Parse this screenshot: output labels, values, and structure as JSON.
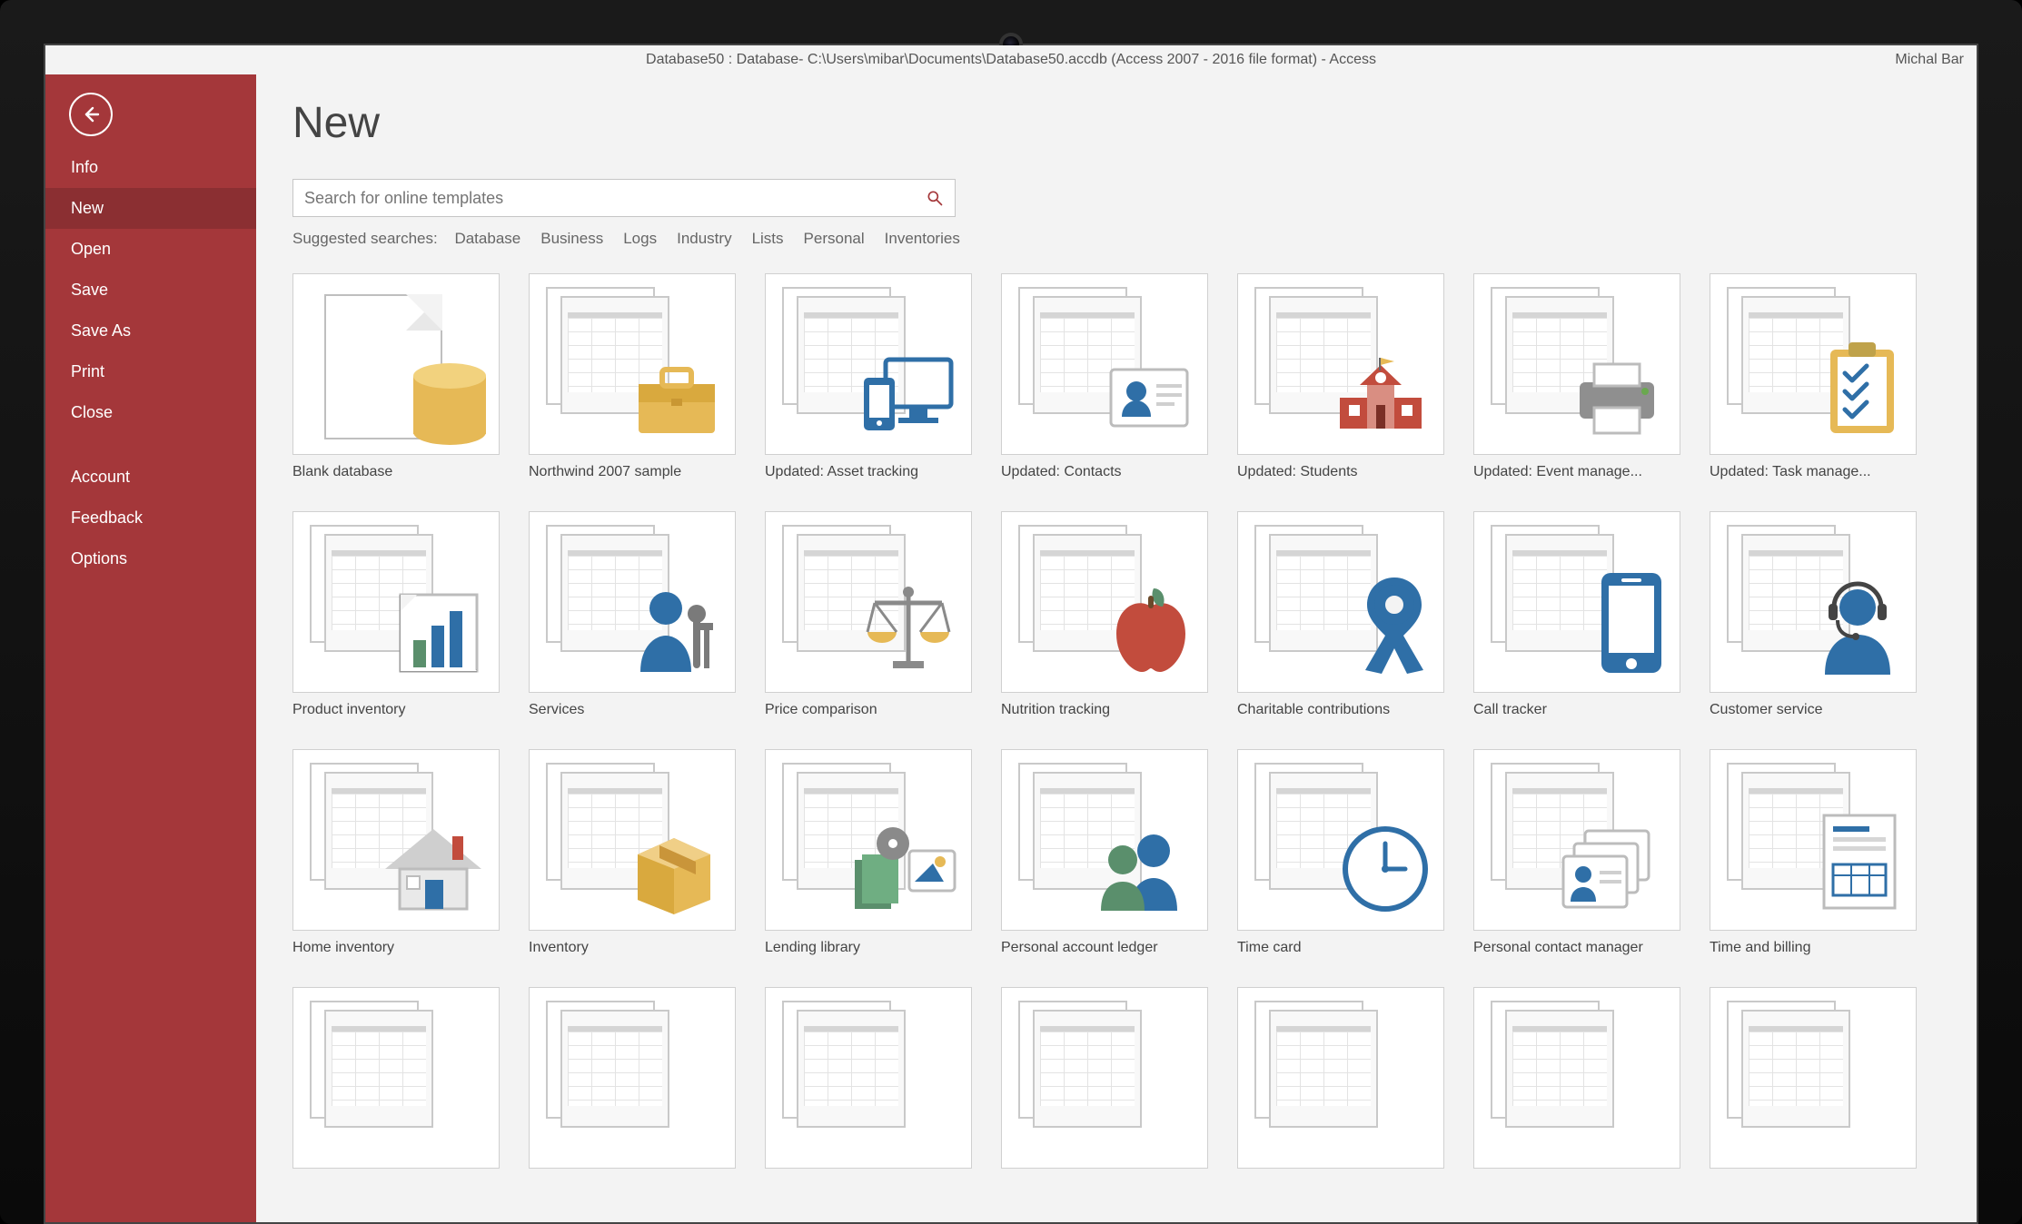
{
  "titlebar": {
    "text": "Database50 : Database- C:\\Users\\mibar\\Documents\\Database50.accdb (Access 2007 - 2016 file format)  -  Access",
    "user": "Michal Bar"
  },
  "sidebar": {
    "items": [
      {
        "label": "Info"
      },
      {
        "label": "New",
        "selected": true
      },
      {
        "label": "Open"
      },
      {
        "label": "Save"
      },
      {
        "label": "Save As"
      },
      {
        "label": "Print"
      },
      {
        "label": "Close"
      }
    ],
    "lower": [
      {
        "label": "Account"
      },
      {
        "label": "Feedback"
      },
      {
        "label": "Options"
      }
    ]
  },
  "page": {
    "title": "New",
    "search_placeholder": "Search for online templates",
    "suggested_label": "Suggested searches:",
    "suggested": [
      "Database",
      "Business",
      "Logs",
      "Industry",
      "Lists",
      "Personal",
      "Inventories"
    ]
  },
  "templates": [
    {
      "id": "blank",
      "label": "Blank database",
      "icon": "blank"
    },
    {
      "id": "northwind",
      "label": "Northwind 2007 sample",
      "icon": "briefcase"
    },
    {
      "id": "asset-tracking",
      "label": "Updated: Asset tracking",
      "icon": "devices"
    },
    {
      "id": "contacts",
      "label": "Updated: Contacts",
      "icon": "contact-card"
    },
    {
      "id": "students",
      "label": "Updated: Students",
      "icon": "school"
    },
    {
      "id": "event-mgmt",
      "label": "Updated: Event manage...",
      "icon": "printer"
    },
    {
      "id": "task-mgmt",
      "label": "Updated: Task manage...",
      "icon": "clipboard"
    },
    {
      "id": "product-inv",
      "label": "Product inventory",
      "icon": "bar-chart"
    },
    {
      "id": "services",
      "label": "Services",
      "icon": "service-person"
    },
    {
      "id": "price-compare",
      "label": "Price comparison",
      "icon": "scales"
    },
    {
      "id": "nutrition",
      "label": "Nutrition tracking",
      "icon": "apple"
    },
    {
      "id": "charity",
      "label": "Charitable contributions",
      "icon": "ribbon"
    },
    {
      "id": "call-tracker",
      "label": "Call tracker",
      "icon": "phone"
    },
    {
      "id": "cust-service",
      "label": "Customer service",
      "icon": "headset-person"
    },
    {
      "id": "home-inv",
      "label": "Home inventory",
      "icon": "house"
    },
    {
      "id": "inventory",
      "label": "Inventory",
      "icon": "box"
    },
    {
      "id": "lending-lib",
      "label": "Lending library",
      "icon": "media"
    },
    {
      "id": "ledger",
      "label": "Personal account ledger",
      "icon": "people"
    },
    {
      "id": "time-card",
      "label": "Time card",
      "icon": "clock"
    },
    {
      "id": "contact-mgr",
      "label": "Personal contact manager",
      "icon": "id-cards"
    },
    {
      "id": "time-billing",
      "label": "Time and billing",
      "icon": "invoice"
    },
    {
      "id": "row4a",
      "label": "",
      "icon": "none"
    },
    {
      "id": "row4b",
      "label": "",
      "icon": "none"
    },
    {
      "id": "row4c",
      "label": "",
      "icon": "none"
    },
    {
      "id": "row4d",
      "label": "",
      "icon": "none"
    },
    {
      "id": "row4e",
      "label": "",
      "icon": "none"
    },
    {
      "id": "row4f",
      "label": "",
      "icon": "none"
    },
    {
      "id": "row4g",
      "label": "",
      "icon": "none"
    }
  ],
  "colors": {
    "accent": "#a4373a",
    "blue": "#2f6fa7",
    "amber": "#e6b956",
    "green": "#5a8f6c",
    "red": "#c24c3d"
  }
}
